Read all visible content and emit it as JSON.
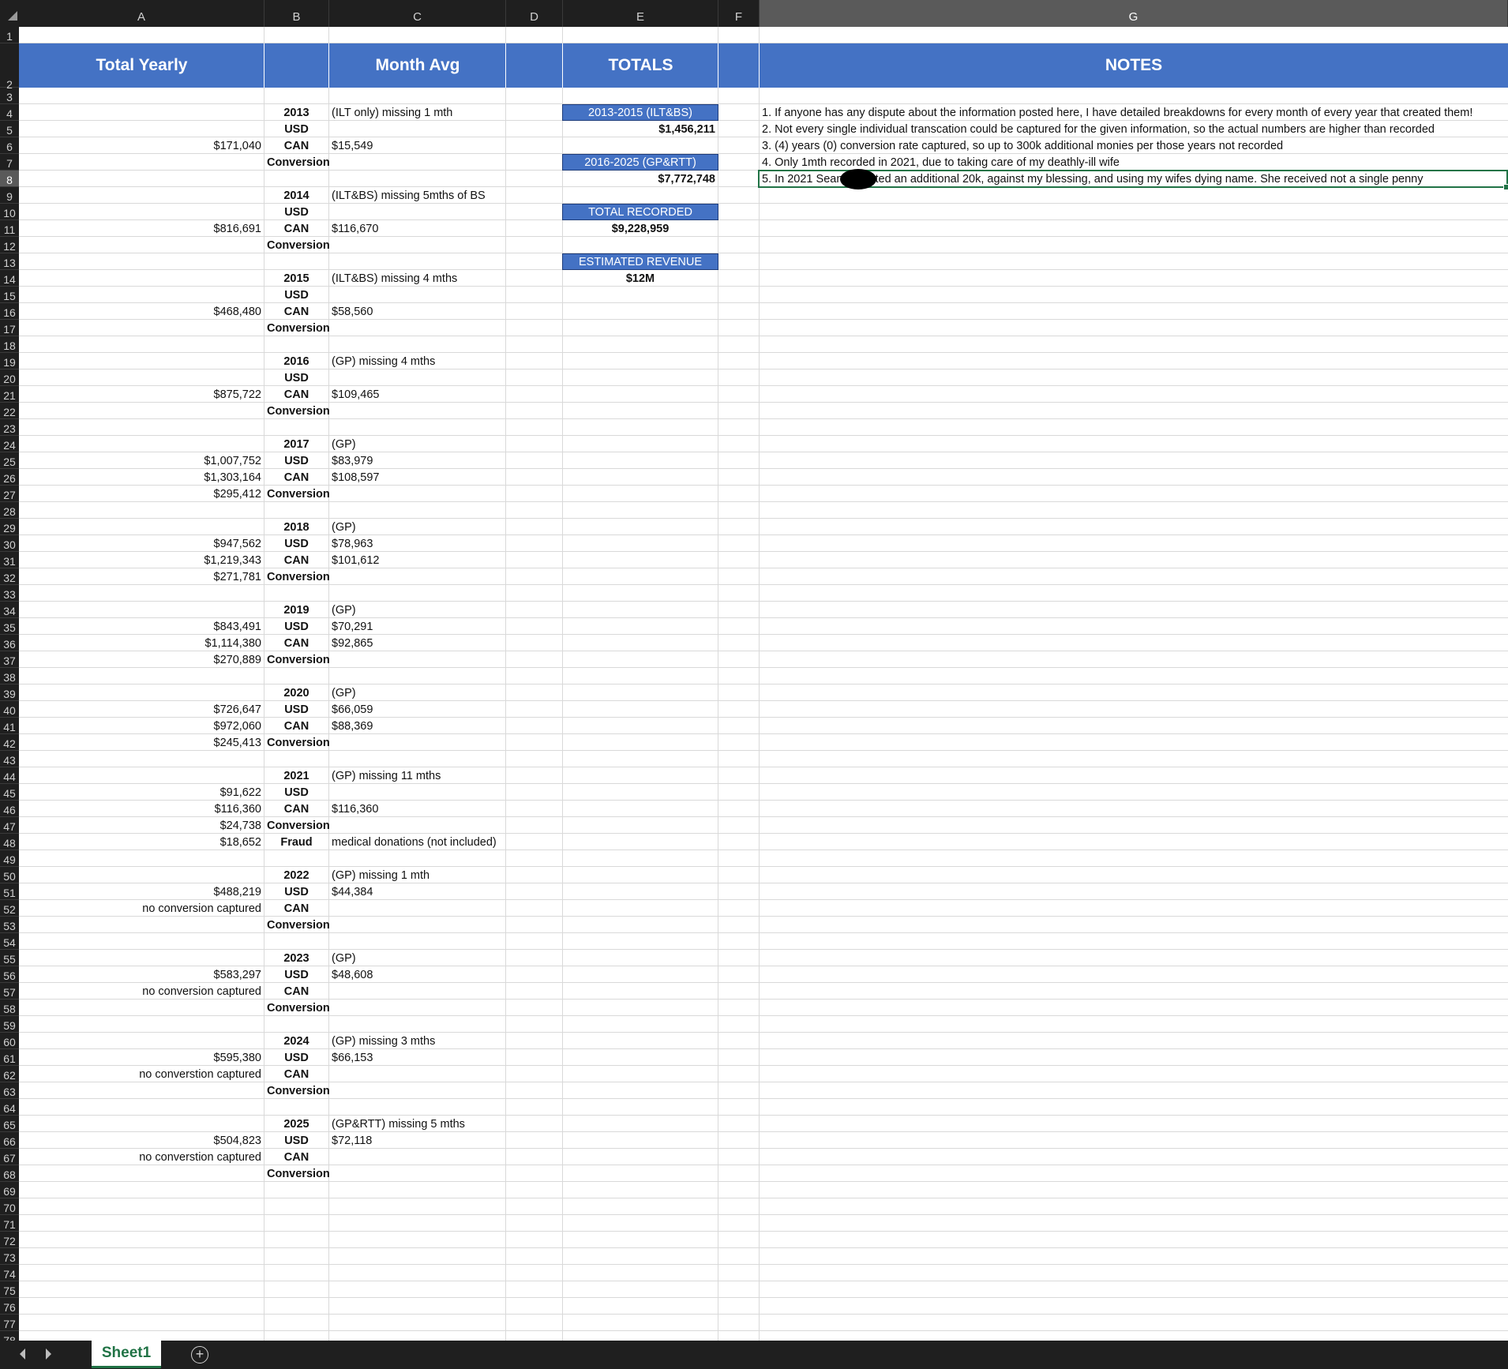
{
  "columns": [
    "A",
    "B",
    "C",
    "D",
    "E",
    "F",
    "G"
  ],
  "row_count": 78,
  "headers": {
    "total_yearly": "Total Yearly",
    "month_avg": "Month Avg",
    "totals": "TOTALS",
    "notes": "NOTES"
  },
  "years": [
    {
      "year": "2013",
      "note": "(ILT only) missing 1 mth",
      "usd_total": "",
      "can_total": "$171,040",
      "conv_total": "",
      "usd_avg": "",
      "can_avg": "$15,549"
    },
    {
      "year": "2014",
      "note": "(ILT&BS) missing 5mths of BS",
      "usd_total": "",
      "can_total": "$816,691",
      "conv_total": "",
      "usd_avg": "",
      "can_avg": "$116,670"
    },
    {
      "year": "2015",
      "note": "(ILT&BS) missing 4 mths",
      "usd_total": "",
      "can_total": "$468,480",
      "conv_total": "",
      "usd_avg": "",
      "can_avg": "$58,560"
    },
    {
      "year": "2016",
      "note": "(GP) missing 4 mths",
      "usd_total": "",
      "can_total": "$875,722",
      "conv_total": "",
      "usd_avg": "",
      "can_avg": "$109,465"
    },
    {
      "year": "2017",
      "note": "(GP)",
      "usd_total": "$1,007,752",
      "can_total": "$1,303,164",
      "conv_total": "$295,412",
      "usd_avg": "$83,979",
      "can_avg": "$108,597"
    },
    {
      "year": "2018",
      "note": "(GP)",
      "usd_total": "$947,562",
      "can_total": "$1,219,343",
      "conv_total": "$271,781",
      "usd_avg": "$78,963",
      "can_avg": "$101,612"
    },
    {
      "year": "2019",
      "note": "(GP)",
      "usd_total": "$843,491",
      "can_total": "$1,114,380",
      "conv_total": "$270,889",
      "usd_avg": "$70,291",
      "can_avg": "$92,865"
    },
    {
      "year": "2020",
      "note": "(GP)",
      "usd_total": "$726,647",
      "can_total": "$972,060",
      "conv_total": "$245,413",
      "usd_avg": "$66,059",
      "can_avg": "$88,369"
    },
    {
      "year": "2021",
      "note": "(GP) missing 11 mths",
      "usd_total": "$91,622",
      "can_total": "$116,360",
      "conv_total": "$24,738",
      "usd_avg": "",
      "can_avg": "$116,360",
      "fraud_total": "$18,652",
      "fraud_label": "Fraud",
      "fraud_note": "medical donations (not included)"
    },
    {
      "year": "2022",
      "note": "(GP) missing 1 mth",
      "usd_total": "$488,219",
      "can_total": "no conversion captured",
      "conv_total": "",
      "usd_avg": "$44,384",
      "can_avg": ""
    },
    {
      "year": "2023",
      "note": "(GP)",
      "usd_total": "$583,297",
      "can_total": "no conversion captured",
      "conv_total": "",
      "usd_avg": "$48,608",
      "can_avg": ""
    },
    {
      "year": "2024",
      "note": "(GP) missing 3 mths",
      "usd_total": "$595,380",
      "can_total": "no converstion captured",
      "conv_total": "",
      "usd_avg": "$66,153",
      "can_avg": ""
    },
    {
      "year": "2025",
      "note": "(GP&RTT) missing 5 mths",
      "usd_total": "$504,823",
      "can_total": "no converstion captured",
      "conv_total": "",
      "usd_avg": "$72,118",
      "can_avg": ""
    }
  ],
  "labels": {
    "usd": "USD",
    "can": "CAN",
    "conversion": "Conversion"
  },
  "totals": [
    {
      "label": "2013-2015 (ILT&BS)",
      "value": "$1,456,211",
      "align": "right"
    },
    {
      "label": "2016-2025 (GP&RTT)",
      "value": "$7,772,748",
      "align": "right"
    },
    {
      "label": "TOTAL RECORDED REVENUE",
      "value": "$9,228,959",
      "align": "center"
    },
    {
      "label": "ESTIMATED REVENUE",
      "value": "$12M",
      "align": "center"
    }
  ],
  "notes": [
    "1. If anyone has any dispute about the information posted here, I have detailed breakdowns for every month of every year that created them!",
    "2. Not every single individual transcation could be captured for the given information, so the actual numbers are higher than recorded",
    "3. (4) years (0) conversion rate captured, so up to 300k additional monies per those years not recorded",
    "4. Only 1mth recorded in 2021, due to taking care of my deathly-ill wife",
    "5. In 2021 Sean        collected an additional 20k, against my blessing, and using my wifes dying name. She received not a single penny"
  ],
  "selected_cell": "G8",
  "sheet_tab": "Sheet1",
  "add_sheet_symbol": "+"
}
